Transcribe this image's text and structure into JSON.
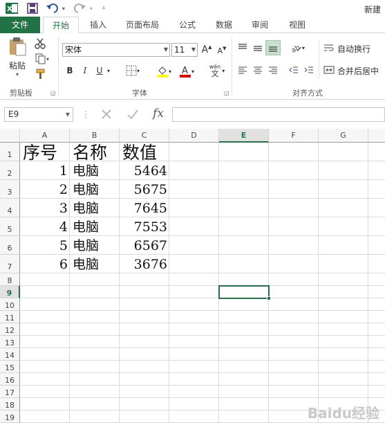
{
  "window": {
    "title": "新建"
  },
  "tabs": [
    "文件",
    "开始",
    "插入",
    "页面布局",
    "公式",
    "数据",
    "审阅",
    "视图"
  ],
  "ribbon": {
    "clipboard": {
      "paste_label": "粘贴",
      "group_label": "剪贴板"
    },
    "font": {
      "name": "宋体",
      "size": "11",
      "group_label": "字体",
      "bold": "B",
      "italic": "I",
      "underline": "U",
      "grow": "A",
      "shrink": "A",
      "phonetic_top": "wén",
      "phonetic_bottom": "文"
    },
    "alignment": {
      "wrap_label": "自动换行",
      "merge_label": "合并后居中",
      "group_label": "对齐方式"
    }
  },
  "formula_bar": {
    "name_box": "E9",
    "fx": "fx",
    "formula": ""
  },
  "columns": [
    "A",
    "B",
    "C",
    "D",
    "E",
    "F",
    "G"
  ],
  "selected_column": "E",
  "rows": [
    "1",
    "2",
    "3",
    "4",
    "5",
    "6",
    "7",
    "8",
    "9",
    "10",
    "11",
    "12",
    "13",
    "14",
    "15",
    "16",
    "17",
    "18",
    "19"
  ],
  "selected_row": "9",
  "table": {
    "headers": [
      "序号",
      "名称",
      "数值"
    ],
    "data": [
      [
        "1",
        "电脑",
        "5464"
      ],
      [
        "2",
        "电脑",
        "5675"
      ],
      [
        "3",
        "电脑",
        "7645"
      ],
      [
        "4",
        "电脑",
        "7553"
      ],
      [
        "5",
        "电脑",
        "6567"
      ],
      [
        "6",
        "电脑",
        "3676"
      ]
    ]
  },
  "watermark": "Baidu经验",
  "colors": {
    "accent": "#217346"
  }
}
